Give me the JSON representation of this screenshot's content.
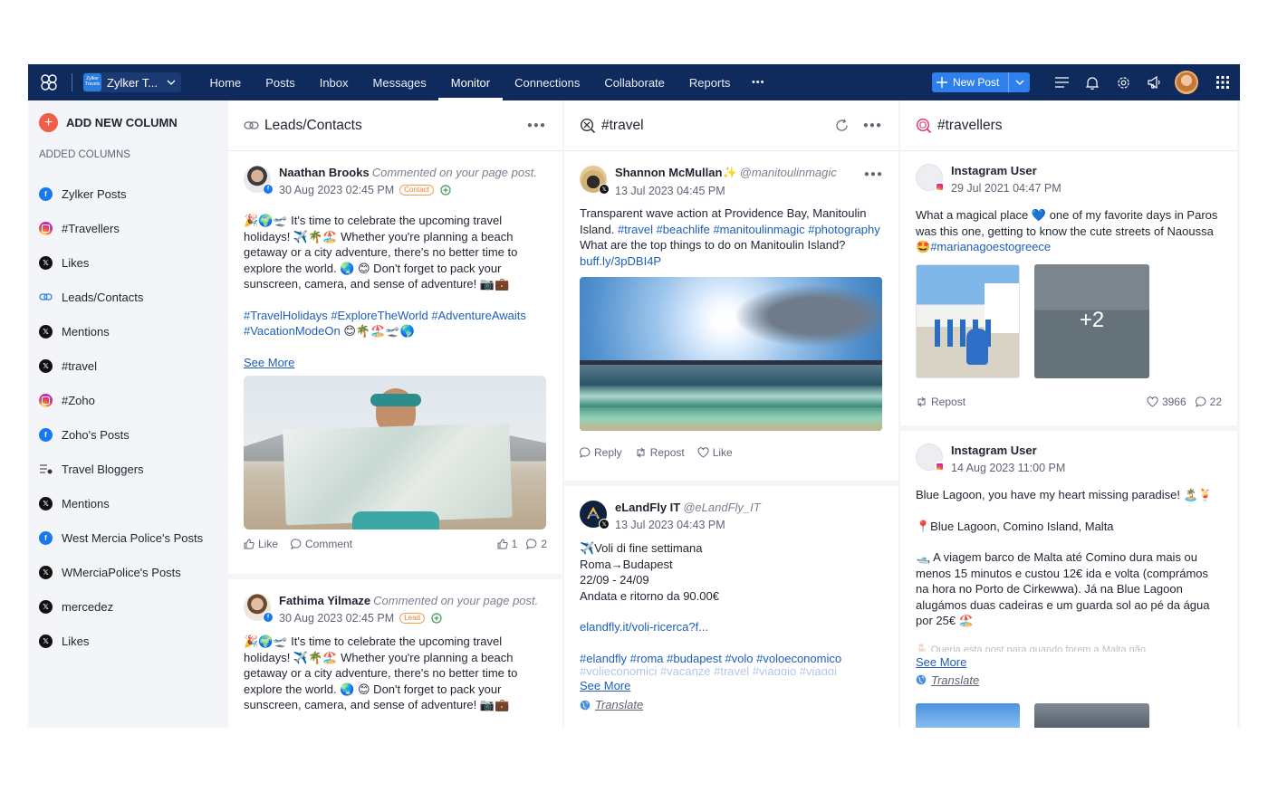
{
  "app": {
    "brand_name": "Zylker T...",
    "brand_logo_text": "Zylker Travels"
  },
  "nav": {
    "items": [
      "Home",
      "Posts",
      "Inbox",
      "Messages",
      "Monitor",
      "Connections",
      "Collaborate",
      "Reports"
    ],
    "active": "Monitor",
    "more": "•••",
    "new_post": "New Post"
  },
  "sidebar": {
    "add_new_column": "ADD NEW COLUMN",
    "added_columns_title": "ADDED COLUMNS",
    "items": [
      {
        "label": "Zylker Posts",
        "icon": "facebook-icon"
      },
      {
        "label": "#Travellers",
        "icon": "instagram-icon"
      },
      {
        "label": "Likes",
        "icon": "x-icon"
      },
      {
        "label": "Leads/Contacts",
        "icon": "link-icon"
      },
      {
        "label": "Mentions",
        "icon": "x-icon"
      },
      {
        "label": "#travel",
        "icon": "x-icon"
      },
      {
        "label": "#Zoho",
        "icon": "instagram-icon"
      },
      {
        "label": "Zoho's Posts",
        "icon": "facebook-icon"
      },
      {
        "label": "Travel Bloggers",
        "icon": "list-icon"
      },
      {
        "label": "Mentions",
        "icon": "x-icon"
      },
      {
        "label": "West Mercia Police's Posts",
        "icon": "facebook-icon"
      },
      {
        "label": "WMerciaPolice's Posts",
        "icon": "x-icon"
      },
      {
        "label": "mercedez",
        "icon": "x-icon"
      },
      {
        "label": "Likes",
        "icon": "x-icon"
      }
    ]
  },
  "col1": {
    "title": "Leads/Contacts",
    "posts": [
      {
        "name": "Naathan Brooks",
        "action": "Commented on your page post.",
        "time": "30 Aug 2023 02:45 PM",
        "tag": "Contact",
        "text": "🎉🌍🛫 It's time to celebrate the upcoming travel holidays! ✈️🌴🏖️ Whether you're planning a beach getaway or a city adventure, there's no better time to explore the world. 🌏 😊 Don't forget to pack your sunscreen, camera, and sense of adventure! 📷💼",
        "hashtags": "#TravelHolidays #ExploreTheWorld #AdventureAwaits #VacationModeOn",
        "hashtags_tail": "😊🌴🏖️🛫🌎",
        "see_more": "See More",
        "like": "Like",
        "comment": "Comment",
        "likes_count": "1",
        "comments_count": "2"
      },
      {
        "name": "Fathima Yilmaze",
        "action": "Commented on your page post.",
        "time": "30 Aug 2023 02:45 PM",
        "tag": "Lead",
        "text": "🎉🌍🛫 It's time to celebrate the upcoming travel holidays! ✈️🌴🏖️ Whether you're planning a beach getaway or a city adventure, there's no better time to explore the world. 🌏 😊 Don't forget to pack your sunscreen, camera, and sense of adventure! 📷💼"
      }
    ]
  },
  "col2": {
    "title": "#travel",
    "posts": [
      {
        "name": "Shannon McMullan",
        "name_suffix": "✨",
        "handle": "@manitoulinmagic",
        "time": "13 Jul 2023 04:45 PM",
        "text1": "Transparent wave action at Providence Bay, Manitoulin Island.",
        "hashtags": "#travel #beachlife #manitoulinmagic #photography",
        "text2": "What are the top things to do on Manitoulin Island?",
        "link": "buff.ly/3pDBI4P",
        "reply": "Reply",
        "repost": "Repost",
        "like": "Like"
      },
      {
        "name": "eLandFly IT",
        "handle": "@eLandFly_IT",
        "time": "13 Jul 2023 04:43 PM",
        "lines": [
          "✈️Voli di fine settimana",
          "Roma→Budapest",
          "22/09 - 24/09",
          "Andata e ritorno da 90.00€"
        ],
        "link": "elandfly.it/voli-ricerca?f...",
        "hashtags": "#elandfly #roma #budapest #volo #voloeconomico",
        "hashtags2": "#volieconomici #vacanze #travel #viaggio #viaggi",
        "see_more": "See More",
        "translate": "Translate"
      }
    ]
  },
  "col3": {
    "title": "#travellers",
    "posts": [
      {
        "name": "Instagram User",
        "time": "29 Jul 2021 04:47 PM",
        "text": "What a magical place 💙 one of my favorite days in Paros was this one, getting to know the cute streets of Naoussa",
        "hashtag_lead": "🤩",
        "hashtags": "#marianagoestogreece",
        "more_images": "+2",
        "repost": "Repost",
        "likes_count": "3966",
        "comments_count": "22"
      },
      {
        "name": "Instagram User",
        "time": "14 Aug 2023 11:00 PM",
        "line1": "Blue Lagoon, you have my heart   missing paradise! 🏝️🍹",
        "line2": "📍Blue Lagoon, Comino Island, Malta",
        "line3": "🛥️ A viagem barco de Malta até Comino dura mais ou menos 15 minutos e custou 12€ ida e volta (comprámos na hora no Porto de Cirkewwa). Já na Blue Lagoon alugámos duas cadeiras e um guarda sol ao pé da água por 25€ 🏖️",
        "line4": "🪑 Queria esta post para quando forem a Malta não",
        "see_more": "See More",
        "translate": "Translate"
      }
    ]
  }
}
